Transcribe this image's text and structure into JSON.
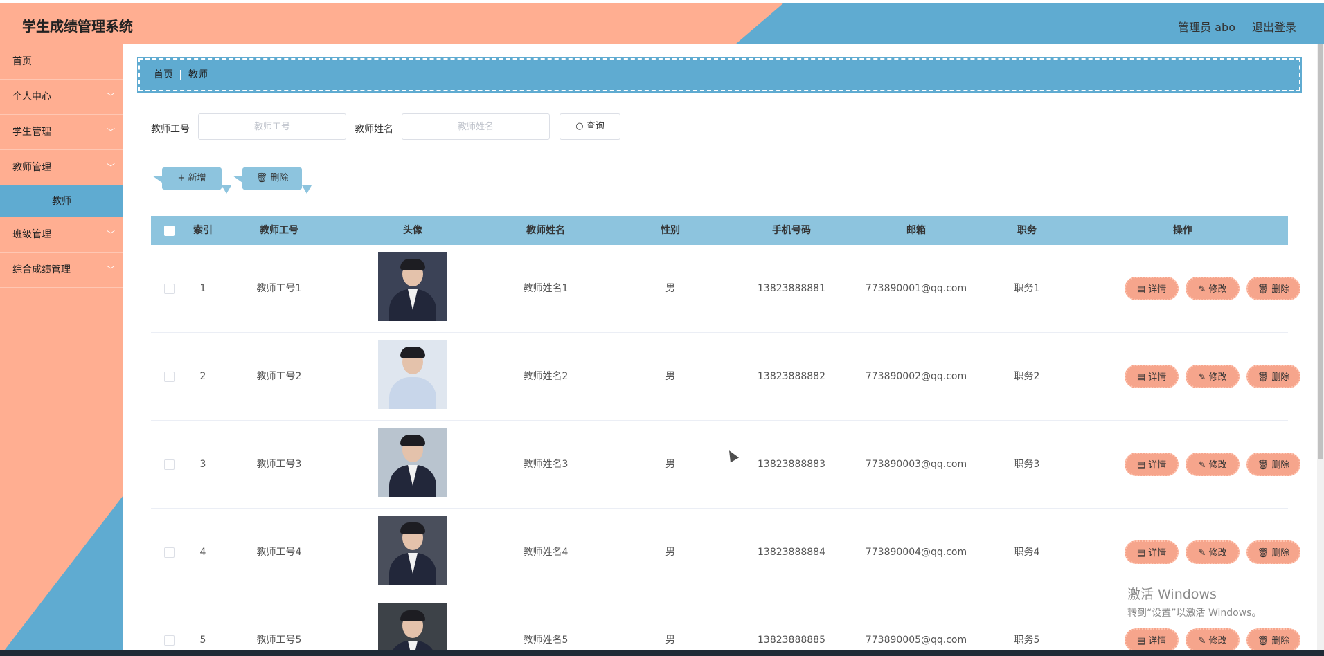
{
  "app": {
    "title": "学生成绩管理系统"
  },
  "header": {
    "admin_label": "管理员 abo",
    "logout_label": "退出登录"
  },
  "sidebar": {
    "items": [
      {
        "label": "首页"
      },
      {
        "label": "个人中心",
        "icon": "chevron-down-icon"
      },
      {
        "label": "学生管理",
        "icon": "chevron-down-icon"
      },
      {
        "label": "教师管理",
        "icon": "chevron-down-icon",
        "sub": "教师"
      },
      {
        "label": "班级管理",
        "icon": "chevron-down-icon"
      },
      {
        "label": "综合成绩管理",
        "icon": "chevron-down-icon"
      }
    ]
  },
  "breadcrumb": {
    "home": "首页",
    "current": "教师"
  },
  "search": {
    "teacher_id_label": "教师工号",
    "teacher_id_placeholder": "教师工号",
    "teacher_name_label": "教师姓名",
    "teacher_name_placeholder": "教师姓名",
    "query_label": "查询"
  },
  "toolbar": {
    "add_label": "新增",
    "delete_label": "删除"
  },
  "table": {
    "columns": [
      "索引",
      "教师工号",
      "头像",
      "教师姓名",
      "性别",
      "手机号码",
      "邮箱",
      "职务",
      "操作"
    ],
    "rows": [
      {
        "index": "1",
        "id": "教师工号1",
        "name": "教师姓名1",
        "gender": "男",
        "phone": "13823888881",
        "email": "773890001@qq.com",
        "title": "职务1"
      },
      {
        "index": "2",
        "id": "教师工号2",
        "name": "教师姓名2",
        "gender": "男",
        "phone": "13823888882",
        "email": "773890002@qq.com",
        "title": "职务2"
      },
      {
        "index": "3",
        "id": "教师工号3",
        "name": "教师姓名3",
        "gender": "男",
        "phone": "13823888883",
        "email": "773890003@qq.com",
        "title": "职务3"
      },
      {
        "index": "4",
        "id": "教师工号4",
        "name": "教师姓名4",
        "gender": "男",
        "phone": "13823888884",
        "email": "773890004@qq.com",
        "title": "职务4"
      },
      {
        "index": "5",
        "id": "教师工号5",
        "name": "教师姓名5",
        "gender": "男",
        "phone": "13823888885",
        "email": "773890005@qq.com",
        "title": "职务5"
      }
    ],
    "actions": {
      "detail": "详情",
      "edit": "修改",
      "delete": "删除"
    }
  },
  "watermark": {
    "line1": "激活 Windows",
    "line2": "转到“设置”以激活 Windows。"
  },
  "colors": {
    "salmon": "#ffae91",
    "blue": "#5fabd1",
    "table_header": "#8dc4de",
    "action_button": "#f6a58c"
  }
}
